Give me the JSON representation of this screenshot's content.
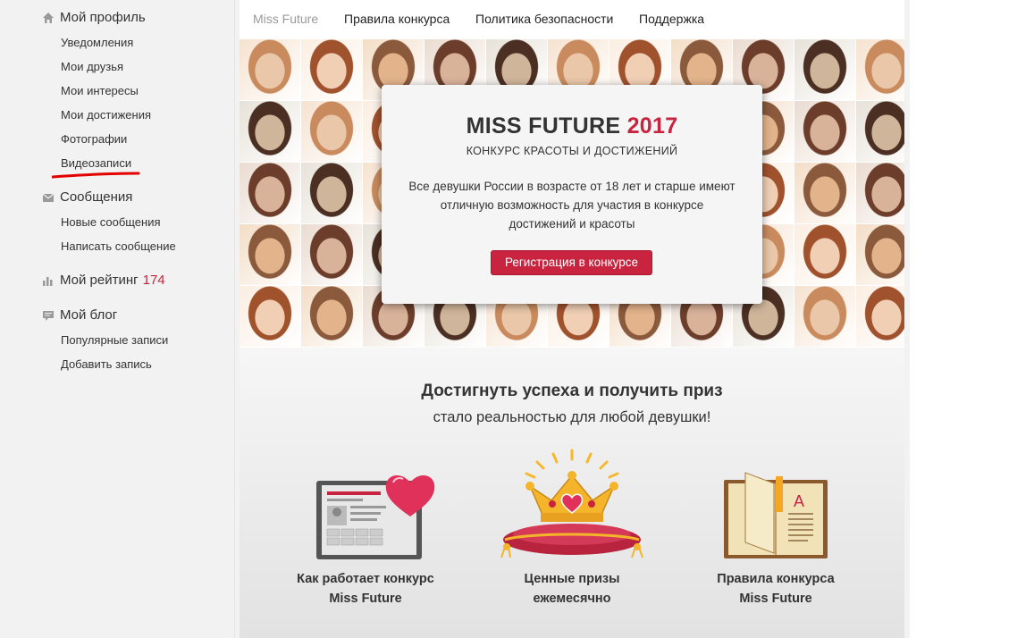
{
  "sidebar": {
    "profile": {
      "title": "Мой профиль",
      "items": [
        "Уведомления",
        "Мои друзья",
        "Мои интересы",
        "Мои достижения",
        "Фотографии",
        "Видеозаписи"
      ]
    },
    "messages": {
      "title": "Сообщения",
      "items": [
        "Новые сообщения",
        "Написать сообщение"
      ]
    },
    "rating": {
      "title": "Мой рейтинг",
      "value": "174"
    },
    "blog": {
      "title": "Мой блог",
      "items": [
        "Популярные записи",
        "Добавить запись"
      ]
    }
  },
  "nav": {
    "brand": "Miss Future",
    "links": [
      "Правила конкурса",
      "Политика безопасности",
      "Поддержка"
    ]
  },
  "hero": {
    "title": "MISS FUTURE",
    "year": "2017",
    "subtitle": "КОНКУРС КРАСОТЫ И ДОСТИЖЕНИЙ",
    "description": "Все девушки России в возрасте от 18 лет и старше имеют отличную возможность для участия в конкурсе достижений и красоты",
    "button": "Регистрация в конкурсе"
  },
  "promo": {
    "heading": "Достигнуть успеха и получить приз",
    "tagline": "стало реальностью для любой девушки!",
    "features": [
      {
        "line1": "Как работает конкурс",
        "line2": "Miss Future"
      },
      {
        "line1": "Ценные призы",
        "line2": "ежемесячно"
      },
      {
        "line1": "Правила конкурса",
        "line2": "Miss Future"
      }
    ]
  },
  "colors": {
    "accent": "#c8243f",
    "sidebar_bg": "#f2f2f2"
  }
}
